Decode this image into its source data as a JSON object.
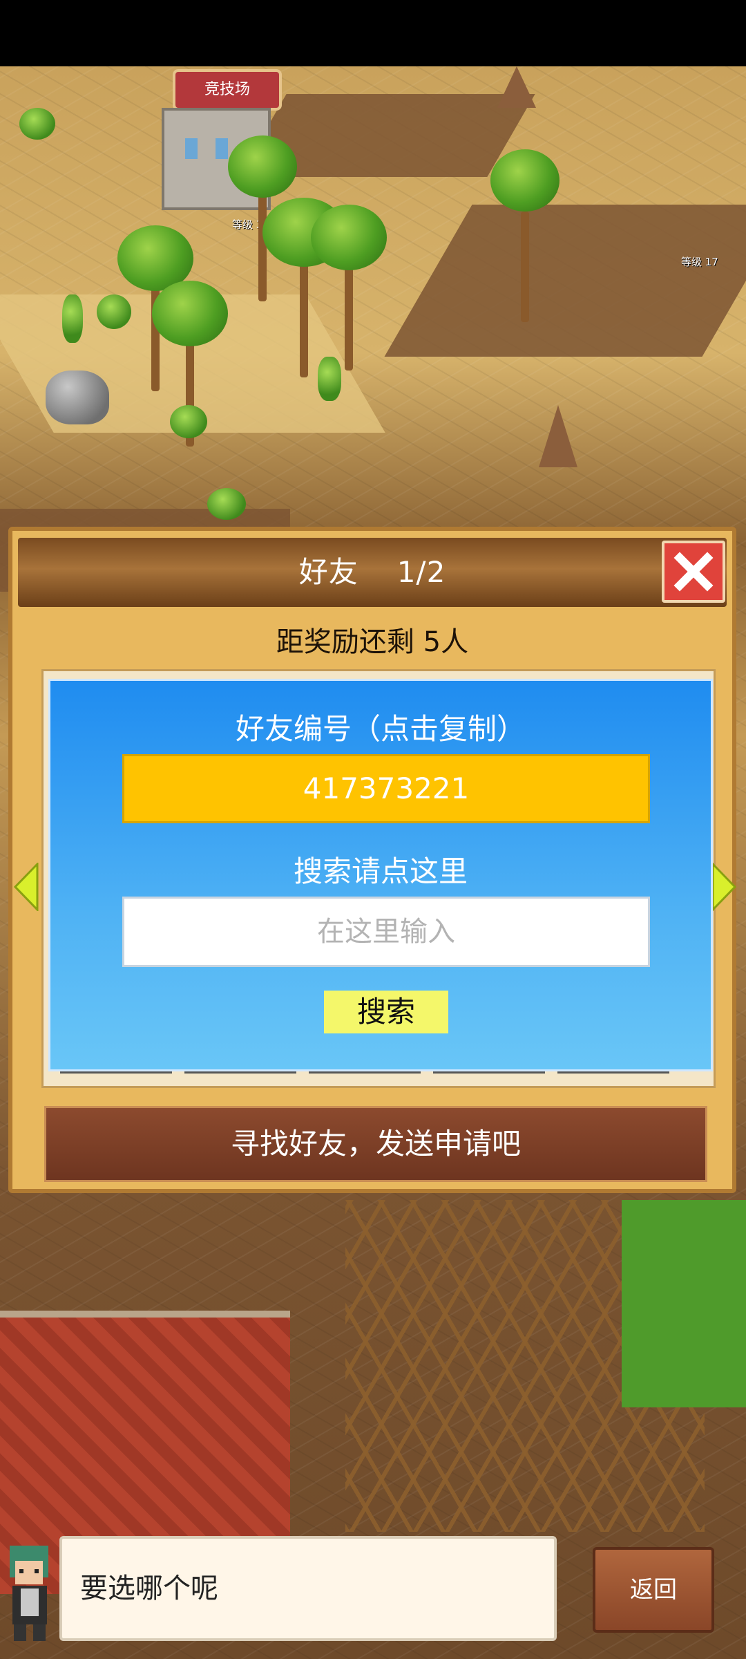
{
  "map": {
    "arena_label": "竞技场",
    "level_tags": [
      "等级 38",
      "等级 17"
    ]
  },
  "dialog": {
    "title": "好友",
    "page": "1/2",
    "reward_text": "距奖励还剩 5人",
    "friend_id_label": "好友编号（点击复制）",
    "friend_id": "417373221",
    "search_label": "搜索请点这里",
    "search_placeholder": "在这里输入",
    "search_value": "",
    "search_button": "搜索",
    "find_friends_button": "寻找好友，发送申请吧",
    "close_icon": "close-icon",
    "nav_icons": [
      "arrow-left-icon",
      "arrow-right-icon"
    ]
  },
  "bottom": {
    "message": "要选哪个呢",
    "back_button": "返回"
  },
  "colors": {
    "dialog_bg": "#e8b85e",
    "panel_blue": "#1f8cf0",
    "id_box": "#ffc300",
    "search_button": "#f4f76a",
    "close_button": "#e0433b"
  }
}
